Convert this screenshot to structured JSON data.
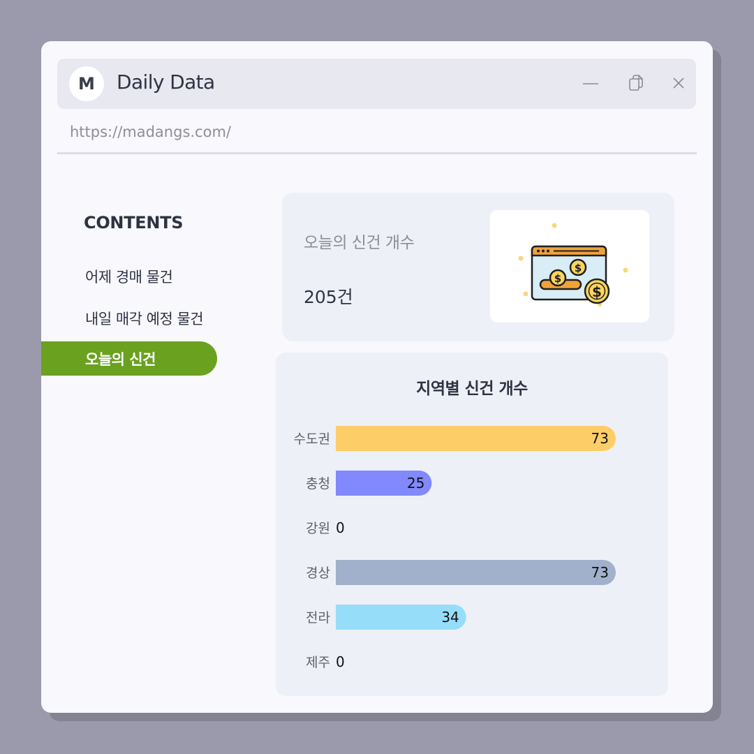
{
  "window": {
    "avatar_letter": "M",
    "title": "Daily Data",
    "url": "https://madangs.com/",
    "controls": [
      "minimize",
      "restore",
      "close"
    ]
  },
  "sidebar": {
    "heading": "CONTENTS",
    "items": [
      {
        "label": "어제 경매 물건",
        "active": false
      },
      {
        "label": "내일 매각 예정 물건",
        "active": false
      },
      {
        "label": "오늘의 신건",
        "active": true
      }
    ],
    "active_color": "#6aa11f"
  },
  "stat": {
    "label": "오늘의 신건 개수",
    "value": "205건",
    "illustration": "web-payment-coins-icon"
  },
  "chart_data": {
    "type": "bar",
    "orientation": "horizontal",
    "title": "지역별 신건 개수",
    "categories": [
      "수도권",
      "충청",
      "강원",
      "경상",
      "전라",
      "제주"
    ],
    "values": [
      73,
      25,
      0,
      73,
      34,
      0
    ],
    "colors": [
      "#fdcd68",
      "#8189fd",
      "#b8c0e0",
      "#a1b1cc",
      "#96ddfa",
      "#c8ccd8"
    ],
    "xlim": [
      0,
      73
    ],
    "grid": false,
    "legend": "none",
    "data_labels": true
  }
}
